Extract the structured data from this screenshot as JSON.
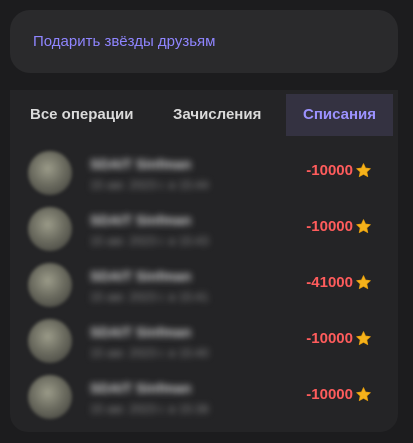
{
  "gift": {
    "label": "Подарить звёзды друзьям"
  },
  "tabs": [
    {
      "label": "Все операции",
      "active": false
    },
    {
      "label": "Зачисления",
      "active": false
    },
    {
      "label": "Списания",
      "active": true
    }
  ],
  "transactions": [
    {
      "title": "SDAIT Sinfman",
      "subtitle": "15 авг. 2023 г. в 15:44",
      "amount": "-10000",
      "icon": "star-icon"
    },
    {
      "title": "SDAIT Sinfman",
      "subtitle": "15 авг. 2023 г. в 15:43",
      "amount": "-10000",
      "icon": "star-icon"
    },
    {
      "title": "SDAIT Sinfman",
      "subtitle": "15 авг. 2023 г. в 15:41",
      "amount": "-41000",
      "icon": "star-icon"
    },
    {
      "title": "SDAIT Sinfman",
      "subtitle": "15 авг. 2023 г. в 15:40",
      "amount": "-10000",
      "icon": "star-icon"
    },
    {
      "title": "SDAIT Sinfman",
      "subtitle": "15 авг. 2023 г. в 15:38",
      "amount": "-10000",
      "icon": "star-icon"
    }
  ],
  "colors": {
    "background": "#1c1c1e",
    "card": "#2a2a2c",
    "accent": "#8f85ff",
    "active_tab_bg": "#343241",
    "negative_amount": "#ff5c5c",
    "star": "#f5b21b"
  }
}
